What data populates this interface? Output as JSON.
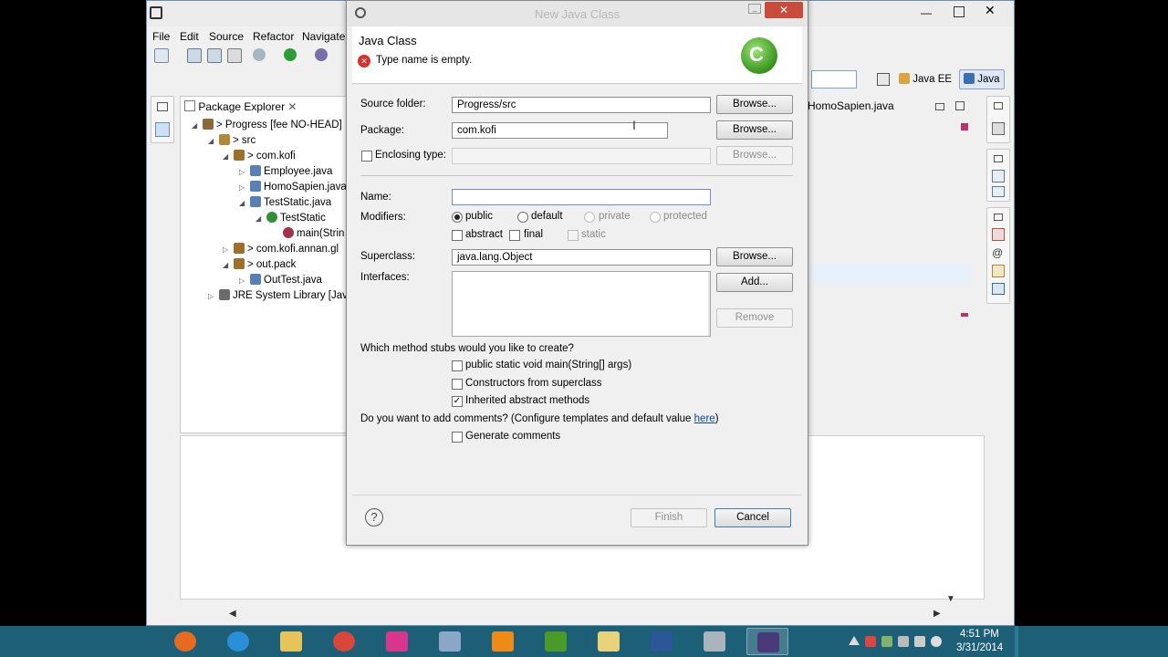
{
  "eclipse": {
    "menu": [
      "File",
      "Edit",
      "Source",
      "Refactor",
      "Navigate"
    ],
    "perspectives": [
      "Java EE",
      "Java"
    ],
    "package_explorer": {
      "title": "Package Explorer",
      "tree": [
        {
          "label": "> Progress [fee NO-HEAD]",
          "depth": 0,
          "icon": "project-icon",
          "expand": "expanded"
        },
        {
          "label": "> src",
          "depth": 1,
          "icon": "source-folder-icon",
          "expand": "expanded"
        },
        {
          "label": "> com.kofi",
          "depth": 2,
          "icon": "package-icon",
          "expand": "expanded"
        },
        {
          "label": "Employee.java",
          "depth": 3,
          "icon": "java-file-icon",
          "expand": "collapsed"
        },
        {
          "label": "HomoSapien.java",
          "depth": 3,
          "icon": "java-file-icon",
          "expand": "collapsed"
        },
        {
          "label": "TestStatic.java",
          "depth": 3,
          "icon": "java-file-icon",
          "expand": "expanded"
        },
        {
          "label": "TestStatic",
          "depth": 4,
          "icon": "class-icon",
          "expand": "expanded"
        },
        {
          "label": "main(Strin",
          "depth": 5,
          "icon": "method-icon",
          "expand": "none"
        },
        {
          "label": "> com.kofi.annan.gl",
          "depth": 2,
          "icon": "package-icon",
          "expand": "collapsed"
        },
        {
          "label": "> out.pack",
          "depth": 2,
          "icon": "package-icon",
          "expand": "expanded"
        },
        {
          "label": "OutTest.java",
          "depth": 3,
          "icon": "java-file-icon",
          "expand": "collapsed"
        },
        {
          "label": "JRE System Library [Java",
          "depth": 1,
          "icon": "library-icon",
          "expand": "collapsed"
        }
      ]
    },
    "editor_tab": "HomoSapien.java"
  },
  "dialog": {
    "window_title": "New Java Class",
    "header_title": "Java Class",
    "error_message": "Type name is empty.",
    "source_folder": {
      "label": "Source folder:",
      "value": "Progress/src",
      "button": "Browse..."
    },
    "package": {
      "label": "Package:",
      "value": "com.kofi",
      "button": "Browse..."
    },
    "enclosing_type": {
      "label": "Enclosing type:",
      "value": "",
      "button": "Browse..."
    },
    "name": {
      "label": "Name:",
      "value": ""
    },
    "modifiers": {
      "label": "Modifiers:",
      "access": [
        "public",
        "default",
        "private",
        "protected"
      ],
      "selected": "public",
      "flags": [
        {
          "label": "abstract",
          "checked": false
        },
        {
          "label": "final",
          "checked": false
        },
        {
          "label": "static",
          "checked": false
        }
      ]
    },
    "superclass": {
      "label": "Superclass:",
      "value": "java.lang.Object",
      "button": "Browse..."
    },
    "interfaces": {
      "label": "Interfaces:",
      "add_button": "Add...",
      "remove_button": "Remove"
    },
    "stubs": {
      "question": "Which method stubs would you like to create?",
      "options": [
        {
          "label": "public static void main(String[] args)",
          "checked": false
        },
        {
          "label": "Constructors from superclass",
          "checked": false
        },
        {
          "label": "Inherited abstract methods",
          "checked": true
        }
      ]
    },
    "comments": {
      "question_prefix": "Do you want to add comments? (Configure templates and default value ",
      "link": "here",
      "question_suffix": ")",
      "generate_label": "Generate comments",
      "generate_checked": false
    },
    "finish_button": "Finish",
    "cancel_button": "Cancel"
  },
  "taskbar": {
    "time": "4:51 PM",
    "date": "3/31/2014",
    "apps": [
      "firefox",
      "internet-explorer",
      "file-explorer",
      "chrome",
      "app-pink",
      "virtualbox",
      "vlc",
      "utorrent",
      "notepad-folder",
      "word",
      "window-app",
      "eclipse"
    ]
  },
  "colors": {
    "taskbar": "#1e5f78",
    "dialog_bg": "#f0f0f0",
    "error_red": "#d9302c",
    "link": "#0645ad"
  }
}
